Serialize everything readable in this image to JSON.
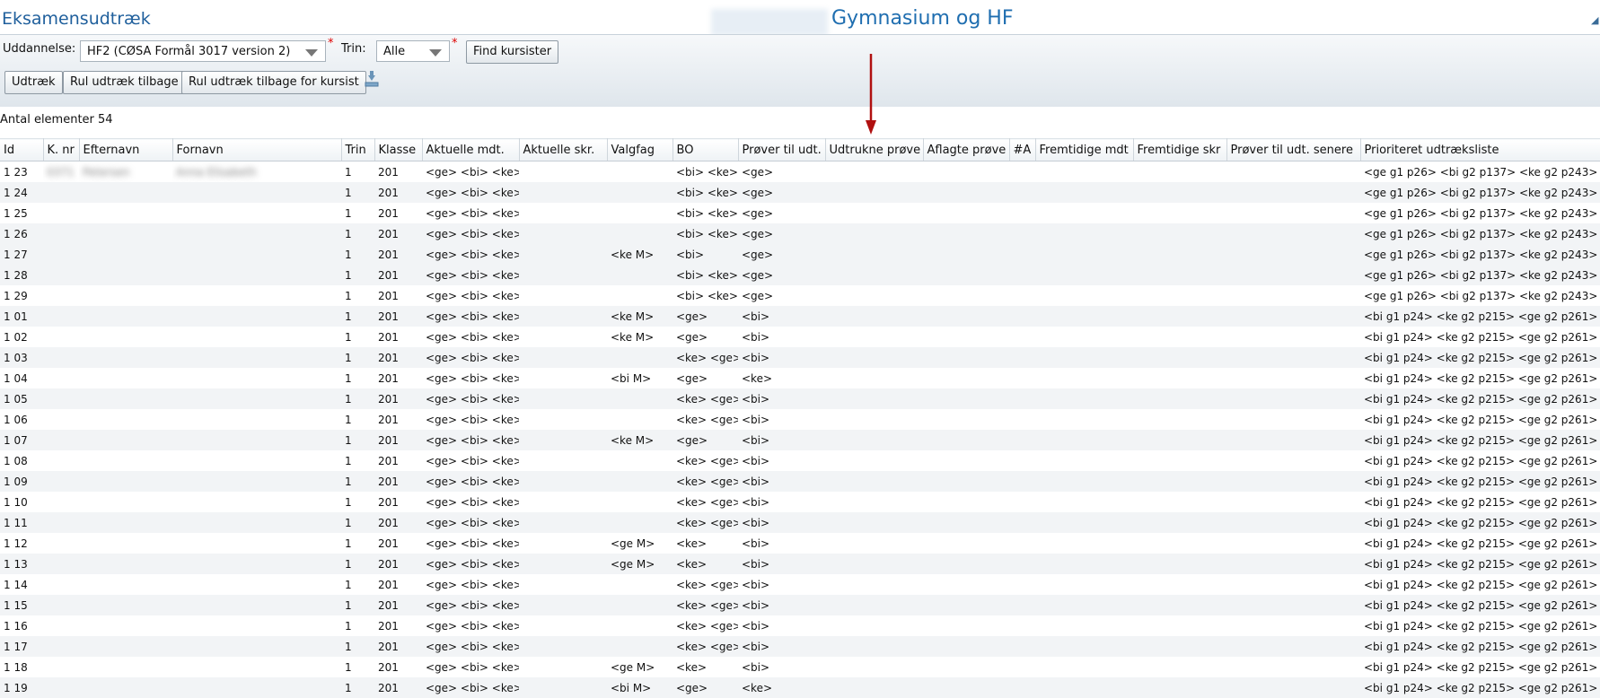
{
  "header": {
    "app_title": "Eksamensudtræk",
    "school_name": "Gymnasium og HF"
  },
  "filters": {
    "uddannelse_label": "Uddannelse:",
    "uddannelse_value": "HF2 (CØSA Formål 3017 version 2)",
    "trin_label": "Trin:",
    "trin_value": "Alle",
    "required_mark": "*",
    "find_button": "Find kursister"
  },
  "actions": {
    "udtraek": "Udtræk",
    "rul_tilbage": "Rul udtræk tilbage",
    "rul_tilbage_kursist": "Rul udtræk tilbage for kursist",
    "download_icon": "download-icon"
  },
  "count_text": "Antal elementer 54",
  "colors": {
    "title": "#1f5f9c",
    "school": "#1f6eb0",
    "required": "#dd0000",
    "annotation_arrow": "#b01010"
  },
  "table": {
    "columns": [
      "Id",
      "K. nr",
      "Efternavn",
      "Fornavn",
      "Trin",
      "Klasse",
      "Aktuelle mdt.",
      "Aktuelle skr.",
      "Valgfag",
      "BO",
      "Prøver til udt.",
      "Udtrukne prøve",
      "Aflagte prøve",
      "#A",
      "Fremtidige mdt",
      "Fremtidige skr",
      "Prøver til udt. senere",
      "Prioriteret udtræksliste"
    ],
    "rows": [
      {
        "id": "1 23",
        "knr": "0371",
        "efternavn": "Petersen",
        "fornavn": "Anna Elisabeth",
        "trin": "1",
        "klasse": "201",
        "mdt": "<ge> <bi> <ke>",
        "valgfag": "",
        "bo": "<bi> <ke>",
        "prover": "<ge>",
        "prio": "<ge g1 p26> <bi g2 p137> <ke g2 p243>"
      },
      {
        "id": "1 24",
        "knr": "",
        "efternavn": "",
        "fornavn": "",
        "trin": "1",
        "klasse": "201",
        "mdt": "<ge> <bi> <ke>",
        "valgfag": "",
        "bo": "<bi> <ke>",
        "prover": "<ge>",
        "prio": "<ge g1 p26> <bi g2 p137> <ke g2 p243>"
      },
      {
        "id": "1 25",
        "knr": "",
        "efternavn": "",
        "fornavn": "",
        "trin": "1",
        "klasse": "201",
        "mdt": "<ge> <bi> <ke>",
        "valgfag": "",
        "bo": "<bi> <ke>",
        "prover": "<ge>",
        "prio": "<ge g1 p26> <bi g2 p137> <ke g2 p243>"
      },
      {
        "id": "1 26",
        "knr": "",
        "efternavn": "",
        "fornavn": "",
        "trin": "1",
        "klasse": "201",
        "mdt": "<ge> <bi> <ke>",
        "valgfag": "",
        "bo": "<bi> <ke>",
        "prover": "<ge>",
        "prio": "<ge g1 p26> <bi g2 p137> <ke g2 p243>"
      },
      {
        "id": "1 27",
        "knr": "",
        "efternavn": "",
        "fornavn": "",
        "trin": "1",
        "klasse": "201",
        "mdt": "<ge> <bi> <ke>",
        "valgfag": "<ke M>",
        "bo": "<bi>",
        "prover": "<ge>",
        "prio": "<ge g1 p26> <bi g2 p137> <ke g2 p243>"
      },
      {
        "id": "1 28",
        "knr": "",
        "efternavn": "",
        "fornavn": "",
        "trin": "1",
        "klasse": "201",
        "mdt": "<ge> <bi> <ke>",
        "valgfag": "",
        "bo": "<bi> <ke>",
        "prover": "<ge>",
        "prio": "<ge g1 p26> <bi g2 p137> <ke g2 p243>"
      },
      {
        "id": "1 29",
        "knr": "",
        "efternavn": "",
        "fornavn": "",
        "trin": "1",
        "klasse": "201",
        "mdt": "<ge> <bi> <ke>",
        "valgfag": "",
        "bo": "<bi> <ke>",
        "prover": "<ge>",
        "prio": "<ge g1 p26> <bi g2 p137> <ke g2 p243>"
      },
      {
        "id": "1 01",
        "knr": "",
        "efternavn": "",
        "fornavn": "",
        "trin": "1",
        "klasse": "201",
        "mdt": "<ge> <bi> <ke>",
        "valgfag": "<ke M>",
        "bo": "<ge>",
        "prover": "<bi>",
        "prio": "<bi g1 p24> <ke g2 p215> <ge g2 p261>"
      },
      {
        "id": "1 02",
        "knr": "",
        "efternavn": "",
        "fornavn": "",
        "trin": "1",
        "klasse": "201",
        "mdt": "<ge> <bi> <ke>",
        "valgfag": "<ke M>",
        "bo": "<ge>",
        "prover": "<bi>",
        "prio": "<bi g1 p24> <ke g2 p215> <ge g2 p261>"
      },
      {
        "id": "1 03",
        "knr": "",
        "efternavn": "",
        "fornavn": "",
        "trin": "1",
        "klasse": "201",
        "mdt": "<ge> <bi> <ke>",
        "valgfag": "",
        "bo": "<ke> <ge>",
        "prover": "<bi>",
        "prio": "<bi g1 p24> <ke g2 p215> <ge g2 p261>"
      },
      {
        "id": "1 04",
        "knr": "",
        "efternavn": "",
        "fornavn": "",
        "trin": "1",
        "klasse": "201",
        "mdt": "<ge> <bi> <ke>",
        "valgfag": "<bi M>",
        "bo": "<ge>",
        "prover": "<ke>",
        "prio": "<bi g1 p24> <ke g2 p215> <ge g2 p261>"
      },
      {
        "id": "1 05",
        "knr": "",
        "efternavn": "",
        "fornavn": "",
        "trin": "1",
        "klasse": "201",
        "mdt": "<ge> <bi> <ke>",
        "valgfag": "",
        "bo": "<ke> <ge>",
        "prover": "<bi>",
        "prio": "<bi g1 p24> <ke g2 p215> <ge g2 p261>"
      },
      {
        "id": "1 06",
        "knr": "",
        "efternavn": "",
        "fornavn": "",
        "trin": "1",
        "klasse": "201",
        "mdt": "<ge> <bi> <ke>",
        "valgfag": "",
        "bo": "<ke> <ge>",
        "prover": "<bi>",
        "prio": "<bi g1 p24> <ke g2 p215> <ge g2 p261>"
      },
      {
        "id": "1 07",
        "knr": "",
        "efternavn": "",
        "fornavn": "",
        "trin": "1",
        "klasse": "201",
        "mdt": "<ge> <bi> <ke>",
        "valgfag": "<ke M>",
        "bo": "<ge>",
        "prover": "<bi>",
        "prio": "<bi g1 p24> <ke g2 p215> <ge g2 p261>"
      },
      {
        "id": "1 08",
        "knr": "",
        "efternavn": "",
        "fornavn": "",
        "trin": "1",
        "klasse": "201",
        "mdt": "<ge> <bi> <ke>",
        "valgfag": "",
        "bo": "<ke> <ge>",
        "prover": "<bi>",
        "prio": "<bi g1 p24> <ke g2 p215> <ge g2 p261>"
      },
      {
        "id": "1 09",
        "knr": "",
        "efternavn": "",
        "fornavn": "",
        "trin": "1",
        "klasse": "201",
        "mdt": "<ge> <bi> <ke>",
        "valgfag": "",
        "bo": "<ke> <ge>",
        "prover": "<bi>",
        "prio": "<bi g1 p24> <ke g2 p215> <ge g2 p261>"
      },
      {
        "id": "1 10",
        "knr": "",
        "efternavn": "",
        "fornavn": "",
        "trin": "1",
        "klasse": "201",
        "mdt": "<ge> <bi> <ke>",
        "valgfag": "",
        "bo": "<ke> <ge>",
        "prover": "<bi>",
        "prio": "<bi g1 p24> <ke g2 p215> <ge g2 p261>"
      },
      {
        "id": "1 11",
        "knr": "",
        "efternavn": "",
        "fornavn": "",
        "trin": "1",
        "klasse": "201",
        "mdt": "<ge> <bi> <ke>",
        "valgfag": "",
        "bo": "<ke> <ge>",
        "prover": "<bi>",
        "prio": "<bi g1 p24> <ke g2 p215> <ge g2 p261>"
      },
      {
        "id": "1 12",
        "knr": "",
        "efternavn": "",
        "fornavn": "",
        "trin": "1",
        "klasse": "201",
        "mdt": "<ge> <bi> <ke>",
        "valgfag": "<ge M>",
        "bo": "<ke>",
        "prover": "<bi>",
        "prio": "<bi g1 p24> <ke g2 p215> <ge g2 p261>"
      },
      {
        "id": "1 13",
        "knr": "",
        "efternavn": "",
        "fornavn": "",
        "trin": "1",
        "klasse": "201",
        "mdt": "<ge> <bi> <ke>",
        "valgfag": "<ge M>",
        "bo": "<ke>",
        "prover": "<bi>",
        "prio": "<bi g1 p24> <ke g2 p215> <ge g2 p261>"
      },
      {
        "id": "1 14",
        "knr": "",
        "efternavn": "",
        "fornavn": "",
        "trin": "1",
        "klasse": "201",
        "mdt": "<ge> <bi> <ke>",
        "valgfag": "",
        "bo": "<ke> <ge>",
        "prover": "<bi>",
        "prio": "<bi g1 p24> <ke g2 p215> <ge g2 p261>"
      },
      {
        "id": "1 15",
        "knr": "",
        "efternavn": "",
        "fornavn": "",
        "trin": "1",
        "klasse": "201",
        "mdt": "<ge> <bi> <ke>",
        "valgfag": "",
        "bo": "<ke> <ge>",
        "prover": "<bi>",
        "prio": "<bi g1 p24> <ke g2 p215> <ge g2 p261>"
      },
      {
        "id": "1 16",
        "knr": "",
        "efternavn": "",
        "fornavn": "",
        "trin": "1",
        "klasse": "201",
        "mdt": "<ge> <bi> <ke>",
        "valgfag": "",
        "bo": "<ke> <ge>",
        "prover": "<bi>",
        "prio": "<bi g1 p24> <ke g2 p215> <ge g2 p261>"
      },
      {
        "id": "1 17",
        "knr": "",
        "efternavn": "",
        "fornavn": "",
        "trin": "1",
        "klasse": "201",
        "mdt": "<ge> <bi> <ke>",
        "valgfag": "",
        "bo": "<ke> <ge>",
        "prover": "<bi>",
        "prio": "<bi g1 p24> <ke g2 p215> <ge g2 p261>"
      },
      {
        "id": "1 18",
        "knr": "",
        "efternavn": "",
        "fornavn": "",
        "trin": "1",
        "klasse": "201",
        "mdt": "<ge> <bi> <ke>",
        "valgfag": "<ge M>",
        "bo": "<ke>",
        "prover": "<bi>",
        "prio": "<bi g1 p24> <ke g2 p215> <ge g2 p261>"
      },
      {
        "id": "1 19",
        "knr": "",
        "efternavn": "",
        "fornavn": "",
        "trin": "1",
        "klasse": "201",
        "mdt": "<ge> <bi> <ke>",
        "valgfag": "<bi M>",
        "bo": "<ge>",
        "prover": "<ke>",
        "prio": "<bi g1 p24> <ke g2 p215> <ge g2 p261>"
      }
    ]
  }
}
